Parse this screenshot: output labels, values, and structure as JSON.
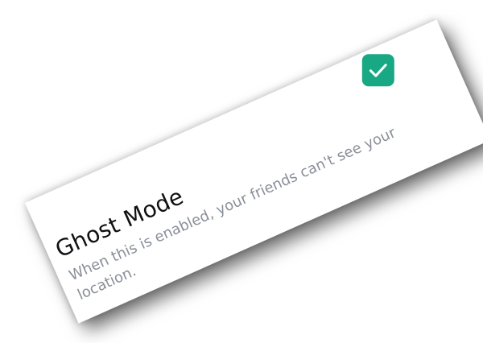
{
  "setting": {
    "title": "Ghost Mode",
    "description": "When this is enabled, your friends can't see your location.",
    "checked": true
  },
  "colors": {
    "accent": "#18a883",
    "title_text": "#111111",
    "description_text": "#8a8f99"
  },
  "icons": {
    "checkbox": "checkmark-icon"
  }
}
